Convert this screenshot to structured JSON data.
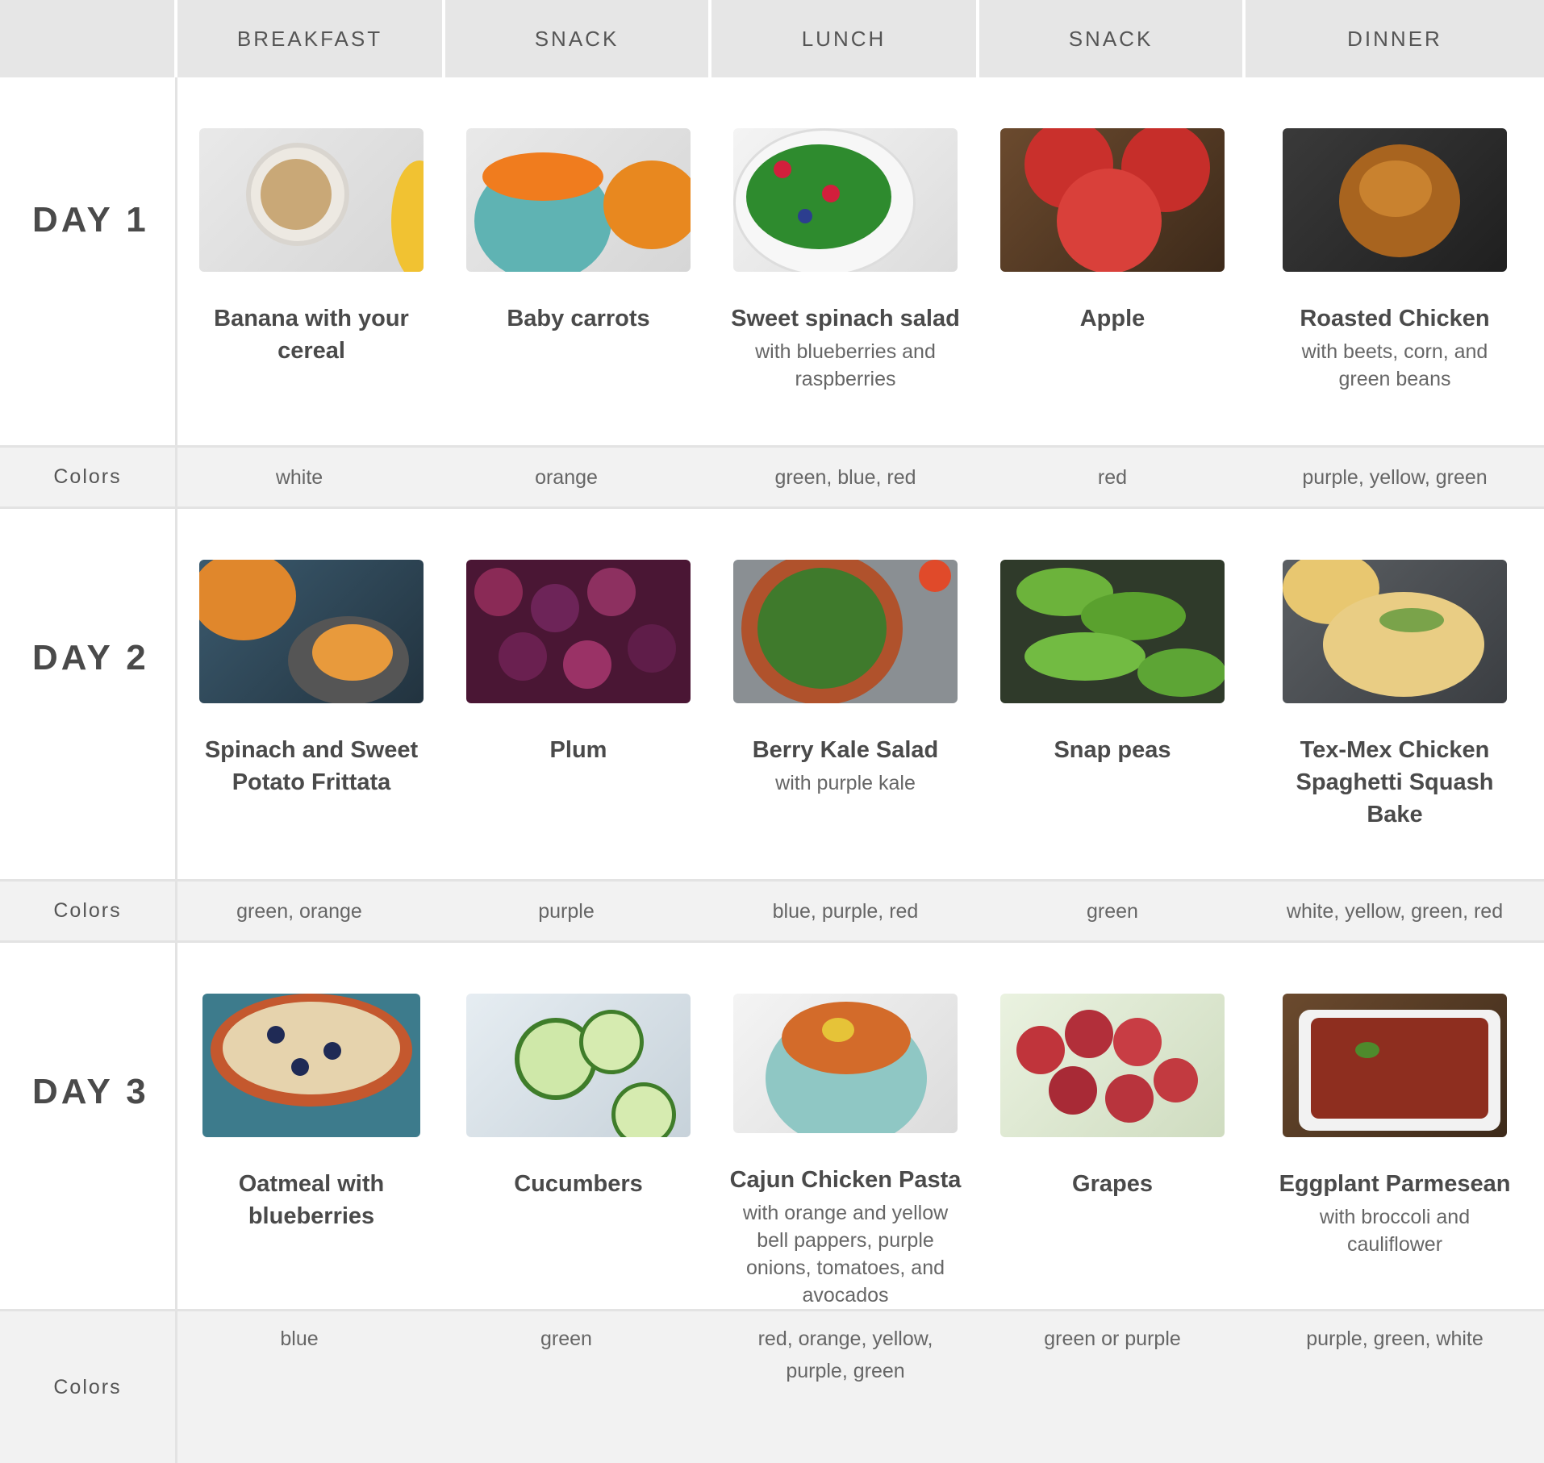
{
  "headers": [
    "BREAKFAST",
    "SNACK",
    "LUNCH",
    "SNACK",
    "DINNER"
  ],
  "colors_label": "Colors",
  "days": [
    {
      "label": "DAY 1",
      "meals": [
        {
          "title": "Banana with your cereal",
          "sub": "",
          "photo": "banana-cereal-photo"
        },
        {
          "title": "Baby carrots",
          "sub": "",
          "photo": "baby-carrots-photo"
        },
        {
          "title": "Sweet spinach salad",
          "sub": "with blueberries and raspberries",
          "photo": "spinach-salad-photo"
        },
        {
          "title": "Apple",
          "sub": "",
          "photo": "apple-photo"
        },
        {
          "title": "Roasted Chicken",
          "sub": "with beets, corn, and green beans",
          "photo": "roasted-chicken-photo"
        }
      ],
      "colors": [
        "white",
        "orange",
        "green, blue, red",
        "red",
        "purple, yellow, green"
      ]
    },
    {
      "label": "DAY 2",
      "meals": [
        {
          "title": "Spinach and Sweet Potato Frittata",
          "sub": "",
          "photo": "frittata-photo"
        },
        {
          "title": "Plum",
          "sub": "",
          "photo": "plum-photo"
        },
        {
          "title": "Berry Kale Salad",
          "sub": "with purple kale",
          "photo": "kale-salad-photo"
        },
        {
          "title": "Snap peas",
          "sub": "",
          "photo": "snap-peas-photo"
        },
        {
          "title": "Tex-Mex Chicken Spaghetti Squash Bake",
          "sub": "",
          "photo": "squash-bake-photo"
        }
      ],
      "colors": [
        "green, orange",
        "purple",
        "blue, purple, red",
        "green",
        "white, yellow, green, red"
      ]
    },
    {
      "label": "DAY 3",
      "meals": [
        {
          "title": "Oatmeal with blueberries",
          "sub": "",
          "photo": "oatmeal-photo"
        },
        {
          "title": "Cucumbers",
          "sub": "",
          "photo": "cucumbers-photo"
        },
        {
          "title": "Cajun Chicken Pasta",
          "sub": "with orange and yellow bell pappers, purple onions, tomatoes, and avocados",
          "photo": "pasta-photo"
        },
        {
          "title": "Grapes",
          "sub": "",
          "photo": "grapes-photo"
        },
        {
          "title": "Eggplant Parmesean",
          "sub": "with broccoli and cauliflower",
          "photo": "eggplant-photo"
        }
      ],
      "colors": [
        "blue",
        "green",
        "red, orange, yellow, purple, green",
        "green or purple",
        "purple, green, white"
      ]
    }
  ]
}
